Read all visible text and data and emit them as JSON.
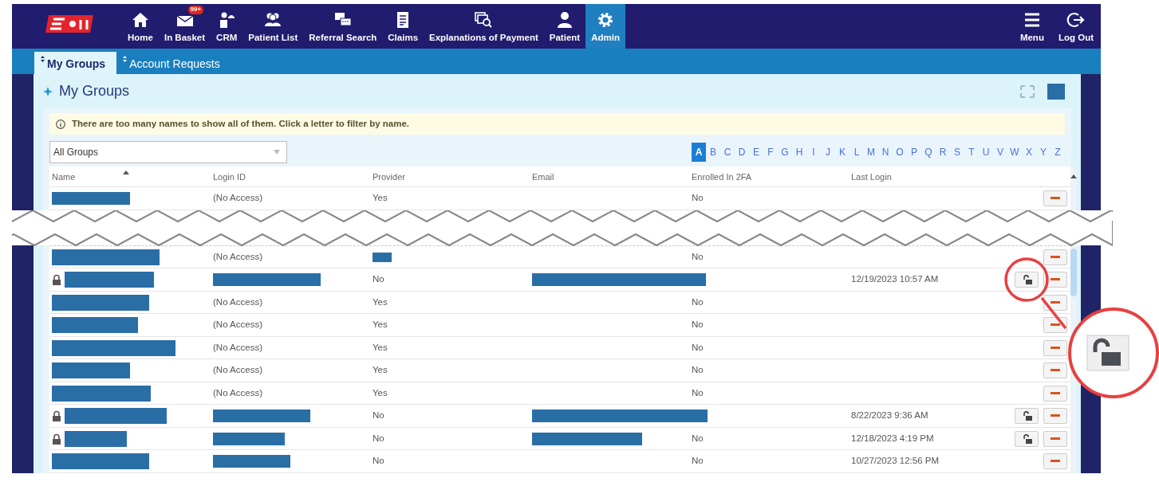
{
  "nav": {
    "items": [
      {
        "label": "Home",
        "kind": "home",
        "selected": false
      },
      {
        "label": "In Basket",
        "kind": "inbox",
        "selected": false,
        "badge": "99+"
      },
      {
        "label": "CRM",
        "kind": "crm",
        "selected": false
      },
      {
        "label": "Patient List",
        "kind": "patients",
        "selected": false
      },
      {
        "label": "Referral Search",
        "kind": "referral",
        "selected": false
      },
      {
        "label": "Claims",
        "kind": "claims",
        "selected": false
      },
      {
        "label": "Explanations of Payment",
        "kind": "eob",
        "selected": false
      },
      {
        "label": "Patient",
        "kind": "patient",
        "selected": false
      },
      {
        "label": "Admin",
        "kind": "admin",
        "selected": true
      }
    ],
    "right_items": [
      {
        "label": "Menu",
        "kind": "menu"
      },
      {
        "label": "Log Out",
        "kind": "logout"
      }
    ]
  },
  "subtabs": [
    {
      "label": "My Groups",
      "selected": true
    },
    {
      "label": "Account Requests",
      "selected": false
    }
  ],
  "panel": {
    "title": "My Groups",
    "notice": "There are too many names to show all of them. Click a letter to filter by name.",
    "group_filter": {
      "value": "All Groups"
    },
    "letters": [
      {
        "label": "A",
        "selected": true
      },
      {
        "label": "B",
        "selected": false
      },
      {
        "label": "C",
        "selected": false
      },
      {
        "label": "D",
        "selected": false
      },
      {
        "label": "E",
        "selected": false
      },
      {
        "label": "F",
        "selected": false
      },
      {
        "label": "G",
        "selected": false
      },
      {
        "label": "H",
        "selected": false
      },
      {
        "label": "I",
        "selected": false
      },
      {
        "label": "J",
        "selected": false
      },
      {
        "label": "K",
        "selected": false
      },
      {
        "label": "L",
        "selected": false
      },
      {
        "label": "M",
        "selected": false
      },
      {
        "label": "N",
        "selected": false
      },
      {
        "label": "O",
        "selected": false
      },
      {
        "label": "P",
        "selected": false
      },
      {
        "label": "Q",
        "selected": false
      },
      {
        "label": "R",
        "selected": false
      },
      {
        "label": "S",
        "selected": false
      },
      {
        "label": "T",
        "selected": false
      },
      {
        "label": "U",
        "selected": false
      },
      {
        "label": "V",
        "selected": false
      },
      {
        "label": "W",
        "selected": false
      },
      {
        "label": "X",
        "selected": false
      },
      {
        "label": "Y",
        "selected": false
      },
      {
        "label": "Z",
        "selected": false
      }
    ]
  },
  "table": {
    "columns": [
      "Name",
      "Login ID",
      "Provider",
      "Email",
      "Enrolled In 2FA",
      "Last Login"
    ],
    "rows_before_break": [
      {
        "locked": false,
        "name_redacted": true,
        "login_id": "(No Access)",
        "provider": "Yes",
        "enrolled_2fa": "No",
        "unlock": false
      }
    ],
    "rows_after_break": [
      {
        "locked": false,
        "name_redacted": true,
        "provider_redacted": true,
        "login_id": "(No Access)",
        "enrolled_2fa": "No",
        "unlock": false
      },
      {
        "locked": true,
        "name_redacted": true,
        "login_id_redacted": true,
        "email_redacted": true,
        "provider": "No",
        "last_login": "12/19/2023 10:57 AM",
        "unlock": true,
        "callout": true
      },
      {
        "locked": false,
        "name_redacted": true,
        "login_id": "(No Access)",
        "provider": "Yes",
        "enrolled_2fa": "No",
        "unlock": false
      },
      {
        "locked": false,
        "name_redacted": true,
        "login_id": "(No Access)",
        "provider": "Yes",
        "enrolled_2fa": "No",
        "unlock": false
      },
      {
        "locked": false,
        "name_redacted": true,
        "login_id": "(No Access)",
        "provider": "Yes",
        "enrolled_2fa": "No",
        "unlock": false
      },
      {
        "locked": false,
        "name_redacted": true,
        "login_id": "(No Access)",
        "provider": "Yes",
        "enrolled_2fa": "No",
        "unlock": false
      },
      {
        "locked": false,
        "name_redacted": true,
        "login_id": "(No Access)",
        "provider": "Yes",
        "enrolled_2fa": "No",
        "unlock": false
      },
      {
        "locked": true,
        "name_redacted": true,
        "login_id_redacted": true,
        "email_redacted": true,
        "provider": "No",
        "last_login": "8/22/2023 9:36 AM",
        "unlock": true
      },
      {
        "locked": true,
        "name_redacted": true,
        "login_id_redacted": true,
        "email_redacted": true,
        "provider": "No",
        "enrolled_2fa": "No",
        "last_login": "12/18/2023 4:19 PM",
        "unlock": true
      },
      {
        "locked": false,
        "name_redacted": true,
        "login_id_redacted": true,
        "provider": "No",
        "enrolled_2fa": "No",
        "last_login": "10/27/2023 12:56 PM",
        "unlock": false
      }
    ]
  }
}
